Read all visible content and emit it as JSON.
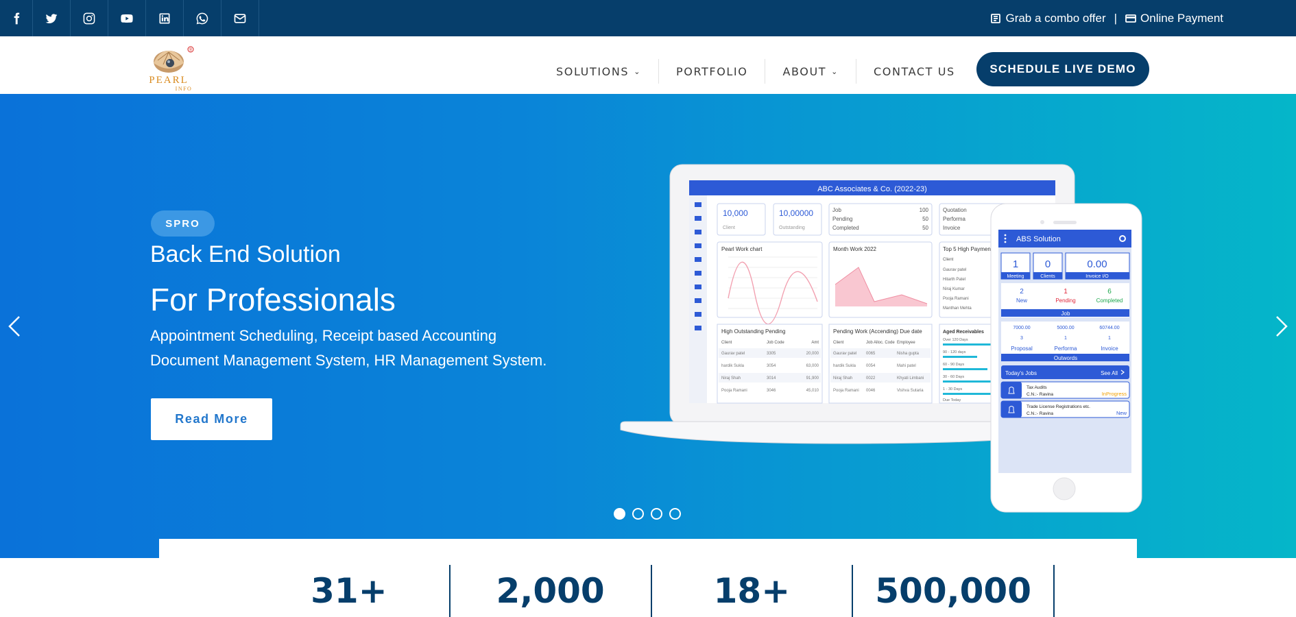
{
  "topbar": {
    "social": [
      "facebook-icon",
      "twitter-icon",
      "instagram-icon",
      "youtube-icon",
      "linkedin-icon",
      "whatsapp-icon",
      "mail-icon"
    ],
    "combo_offer": "Grab a combo offer",
    "separator": "|",
    "online_payment": "Online Payment"
  },
  "brand": {
    "name": "PEARL",
    "sub": "INFO",
    "registered": "®"
  },
  "nav": {
    "items": [
      {
        "label": "SOLUTIONS",
        "has_dropdown": true
      },
      {
        "label": "PORTFOLIO",
        "has_dropdown": false
      },
      {
        "label": "ABOUT",
        "has_dropdown": true
      },
      {
        "label": "CONTACT US",
        "has_dropdown": false
      }
    ],
    "demo_button": "SCHEDULE LIVE DEMO"
  },
  "hero": {
    "badge": "SPRO",
    "title": "Back End Solution",
    "subtitle": "For Professionals",
    "desc_line1": "Appointment Scheduling, Receipt based Accounting",
    "desc_line2": "Document Management System, HR Management System.",
    "cta": "Read More",
    "slides": 4,
    "active_slide": 1
  },
  "laptop": {
    "title": "ABC Associates & Co. (2022-23)",
    "card1_value": "10,000",
    "card1_label": "Client",
    "card2_value": "10,00000",
    "card2_label": "Outstanding",
    "card3": [
      [
        "Job",
        "100"
      ],
      [
        "Pending",
        "50"
      ],
      [
        "Completed",
        "50"
      ]
    ],
    "card4": [
      "Quotation",
      "Performa",
      "Invoice"
    ],
    "chart1_title": "Pearl Work chart",
    "chart2_title": "Month Work 2022",
    "chart3_title": "Top 5 High Payment",
    "chart3_col": "Client",
    "chart3_rows": [
      "Gaurav patel",
      "Hitarth Patel",
      "Niraj Kumar",
      "Pooja Ramani",
      "Manthan Mehta"
    ],
    "table1_title": "High Outstanding Pending",
    "table1_headers": [
      "Client",
      "Job Code",
      "Amt"
    ],
    "table1_rows": [
      [
        "Gaurav patel",
        "3305",
        "20,000"
      ],
      [
        "hardik Sukla",
        "3054",
        "63,000"
      ],
      [
        "Niraj Shah",
        "3014",
        "91,900"
      ],
      [
        "Pooja Ramani",
        "3046",
        "45,010"
      ]
    ],
    "table2_title": "Pending Work (Accending) Due date",
    "table2_headers": [
      "Client",
      "Job Alloc. Code",
      "Employee"
    ],
    "table2_rows": [
      [
        "Gaurav patel",
        "0065",
        "Nisha gupta"
      ],
      [
        "hardik Sukla",
        "0054",
        "Mahi patel"
      ],
      [
        "Niraj Shah",
        "0022",
        "Khyati Limbani"
      ],
      [
        "Pooja Ramani",
        "0046",
        "Vishva Sutaria"
      ]
    ],
    "table3_title": "Aged Receivables",
    "table3_rows": [
      "Over 120 Days",
      "90 - 120 days",
      "60 - 90 Days",
      "30 - 60 Days",
      "1 - 30 Days",
      "Due Today"
    ]
  },
  "phone": {
    "app_title": "ABS Solution",
    "stats": [
      {
        "value": "1",
        "label": "Meeting"
      },
      {
        "value": "0",
        "label": "Clients"
      },
      {
        "value": "0.00",
        "label": "Invoice I/O"
      }
    ],
    "job": [
      {
        "value": "2",
        "label": "New"
      },
      {
        "value": "1",
        "label": "Pending"
      },
      {
        "value": "6",
        "label": "Completed"
      }
    ],
    "job_label": "Job",
    "outwords_values": [
      "7000.00",
      "5000.00",
      "60744.00"
    ],
    "outwords_counts": [
      "3",
      "1",
      "1"
    ],
    "outwords_labels": [
      "Proposal",
      "Performa",
      "Invoice"
    ],
    "outwords_label": "Outwords",
    "todays_jobs": "Today's Jobs",
    "see_all": "See All",
    "jobs": [
      {
        "title": "Tax Audits",
        "by": "C.N.:- Ravina",
        "status": "InProgress"
      },
      {
        "title": "Trade License Registrations etc.",
        "by": "C.N.:- Ravina",
        "status": "New"
      }
    ]
  },
  "stats": [
    "31+",
    "2,000",
    "18+",
    "500,000"
  ],
  "colors": {
    "navy": "#063e6b",
    "hero_start": "#0a72d9",
    "hero_end": "#05b6c9",
    "accent": "#2277cc"
  }
}
